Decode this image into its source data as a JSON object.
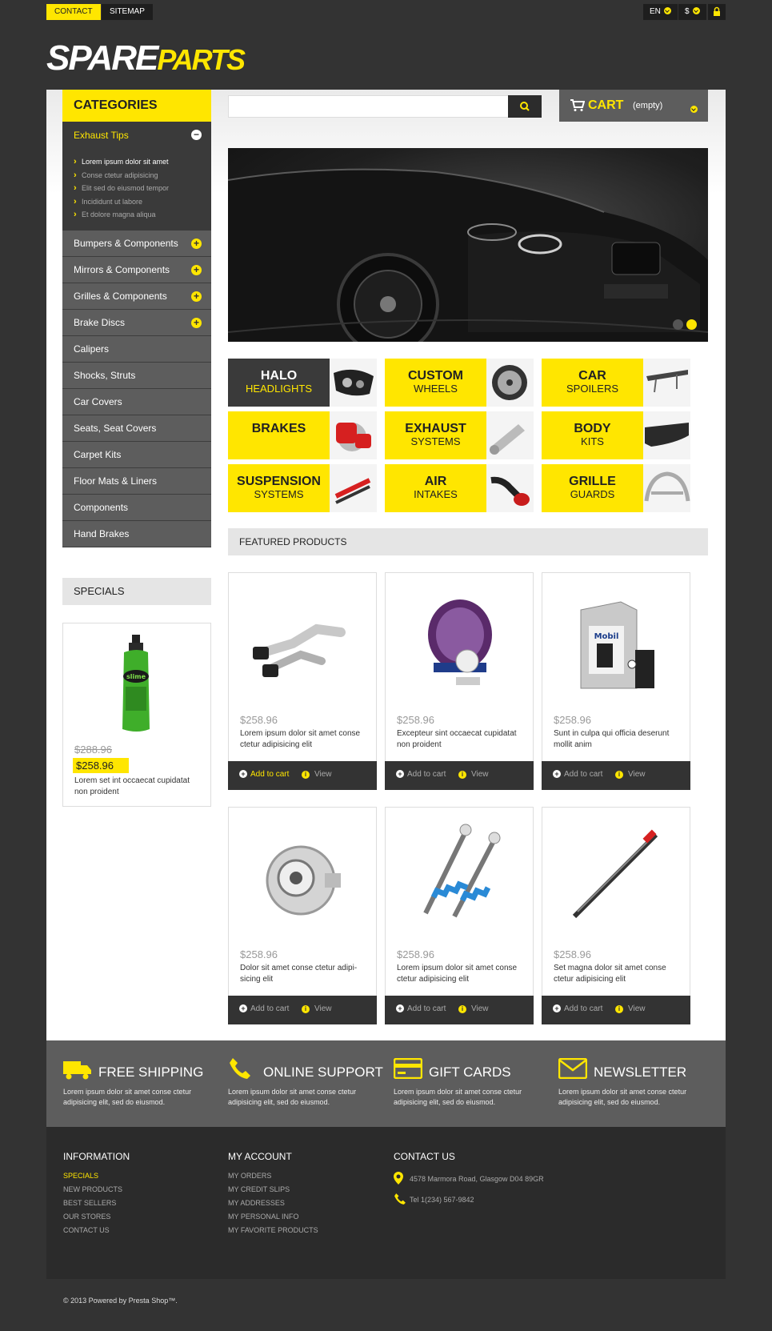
{
  "topbar": {
    "contact_label": "CONTACT",
    "sitemap_label": "SITEMAP",
    "lang": "EN",
    "currency": "$"
  },
  "logo": {
    "part1": "SPARE",
    "part2": "PARTS"
  },
  "categories": {
    "title": "CATEGORIES",
    "open": {
      "label": "Exhaust Tips",
      "subitems": [
        "Lorem ipsum dolor sit amet",
        "Conse ctetur adipisicing",
        "Elit sed do eiusmod tempor",
        "Incididunt ut labore",
        "Et dolore magna aliqua"
      ]
    },
    "items": [
      "Bumpers & Components",
      "Mirrors & Components",
      "Grilles & Components",
      "Brake Discs",
      "Calipers",
      "Shocks, Struts",
      "Car Covers",
      "Seats, Seat Covers",
      "Carpet Kits",
      "Floor Mats & Liners",
      "Components",
      "Hand Brakes"
    ]
  },
  "search": {
    "placeholder": ""
  },
  "cart": {
    "label": "CART",
    "status": "(empty)"
  },
  "tiles": [
    {
      "t1": "HALO",
      "t2": "HEADLIGHTS"
    },
    {
      "t1": "CUSTOM",
      "t2": "WHEELS"
    },
    {
      "t1": "CAR",
      "t2": "SPOILERS"
    },
    {
      "t1": "BRAKES",
      "t2": ""
    },
    {
      "t1": "EXHAUST",
      "t2": "SYSTEMS"
    },
    {
      "t1": "BODY",
      "t2": "KITS"
    },
    {
      "t1": "SUSPENSION",
      "t2": "SYSTEMS"
    },
    {
      "t1": "AIR",
      "t2": "INTAKES"
    },
    {
      "t1": "GRILLE",
      "t2": "GUARDS"
    }
  ],
  "specials": {
    "title": "SPECIALS",
    "old_price": "$288.96",
    "new_price": "$258.96",
    "desc": "Lorem set int occaecat cupidatat non proident"
  },
  "featured": {
    "title": "FEATURED PRODUCTS",
    "add_label": "Add to cart",
    "view_label": "View",
    "products": [
      {
        "price": "$258.96",
        "desc": "Lorem ipsum dolor sit amet conse ctetur adipisicing elit"
      },
      {
        "price": "$258.96",
        "desc": "Excepteur sint occaecat cupidatat non proident"
      },
      {
        "price": "$258.96",
        "desc": "Sunt in culpa qui officia deserunt mollit anim"
      },
      {
        "price": "$258.96",
        "desc": "Dolor sit amet conse ctetur adipi-sicing elit"
      },
      {
        "price": "$258.96",
        "desc": "Lorem ipsum dolor sit amet conse ctetur adipisicing elit"
      },
      {
        "price": "$258.96",
        "desc": "Set magna dolor sit amet conse ctetur adipisicing elit"
      }
    ]
  },
  "band": [
    {
      "title": "FREE SHIPPING",
      "text": "Lorem ipsum dolor sit amet conse ctetur adipisicing elit, sed do eiusmod."
    },
    {
      "title": "ONLINE SUPPORT",
      "text": "Lorem ipsum dolor sit amet conse ctetur adipisicing elit, sed do eiusmod."
    },
    {
      "title": "GIFT CARDS",
      "text": "Lorem ipsum dolor sit amet conse ctetur adipisicing elit, sed do eiusmod."
    },
    {
      "title": "NEWSLETTER",
      "text": "Lorem ipsum dolor sit amet conse ctetur adipisicing elit, sed do eiusmod."
    }
  ],
  "footer": {
    "info_title": "INFORMATION",
    "info_links": [
      "SPECIALS",
      "NEW PRODUCTS",
      "BEST SELLERS",
      "OUR STORES",
      "CONTACT US"
    ],
    "account_title": "MY ACCOUNT",
    "account_links": [
      "MY ORDERS",
      "MY CREDIT SLIPS",
      "MY ADDRESSES",
      "MY PERSONAL INFO",
      "MY FAVORITE PRODUCTS"
    ],
    "contact_title": "CONTACT US",
    "address": "4578 Marmora Road, Glasgow D04 89GR",
    "phone": "Tel 1(234) 567-9842"
  },
  "copyright": "© 2013 Powered by Presta Shop™.",
  "colors": {
    "accent": "#ffe600",
    "dark": "#333333",
    "panel": "#5d5d5d"
  }
}
